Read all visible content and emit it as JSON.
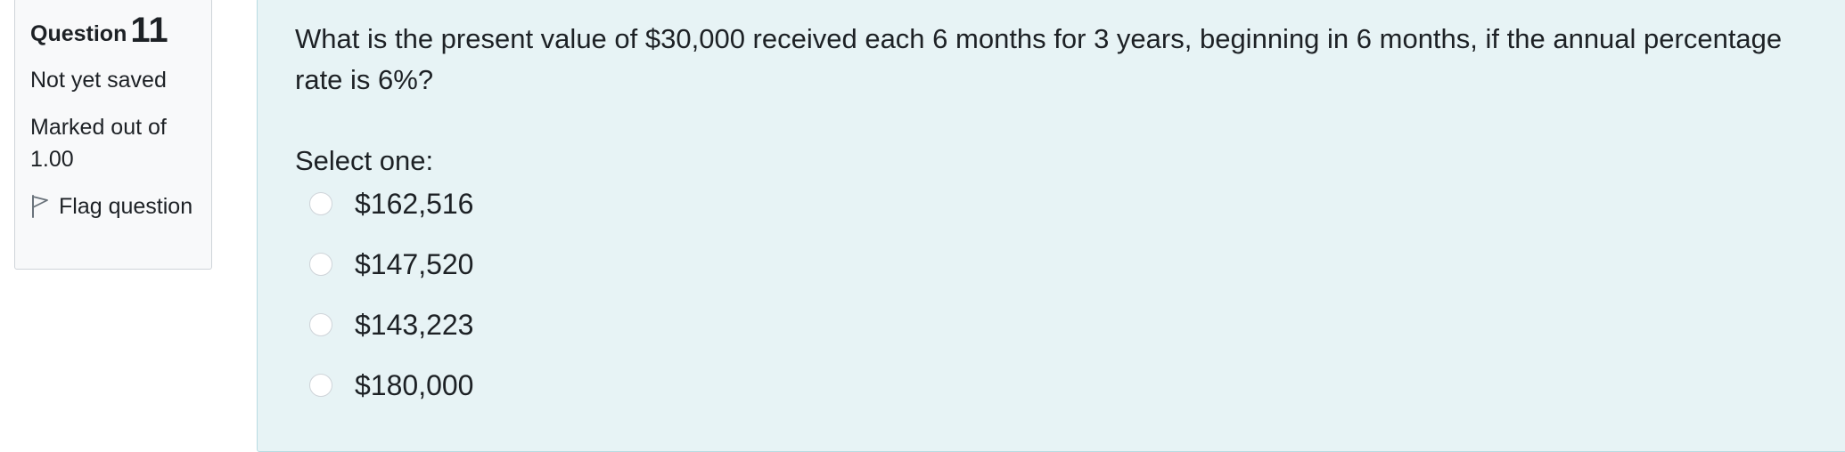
{
  "info": {
    "question_label": "Question",
    "question_number": "11",
    "state": "Not yet saved",
    "grade": "Marked out of 1.00",
    "flag_label": "Flag question"
  },
  "question": {
    "text": "What is the present value of $30,000 received each 6 months for 3 years, beginning in 6 months, if the annual percentage rate is 6%?",
    "prompt": "Select one:",
    "options": [
      {
        "label": "$162,516",
        "selected": false
      },
      {
        "label": "$147,520",
        "selected": false
      },
      {
        "label": "$143,223",
        "selected": false
      },
      {
        "label": "$180,000",
        "selected": false
      }
    ]
  },
  "colors": {
    "info_background": "#f8f9fa",
    "info_border": "#cfd4d9",
    "content_background": "#e7f3f5",
    "content_border": "#b8dce2",
    "text": "#1d2125"
  },
  "icons": {
    "flag": "flag-outline-icon",
    "radio": "radio-unchecked"
  }
}
